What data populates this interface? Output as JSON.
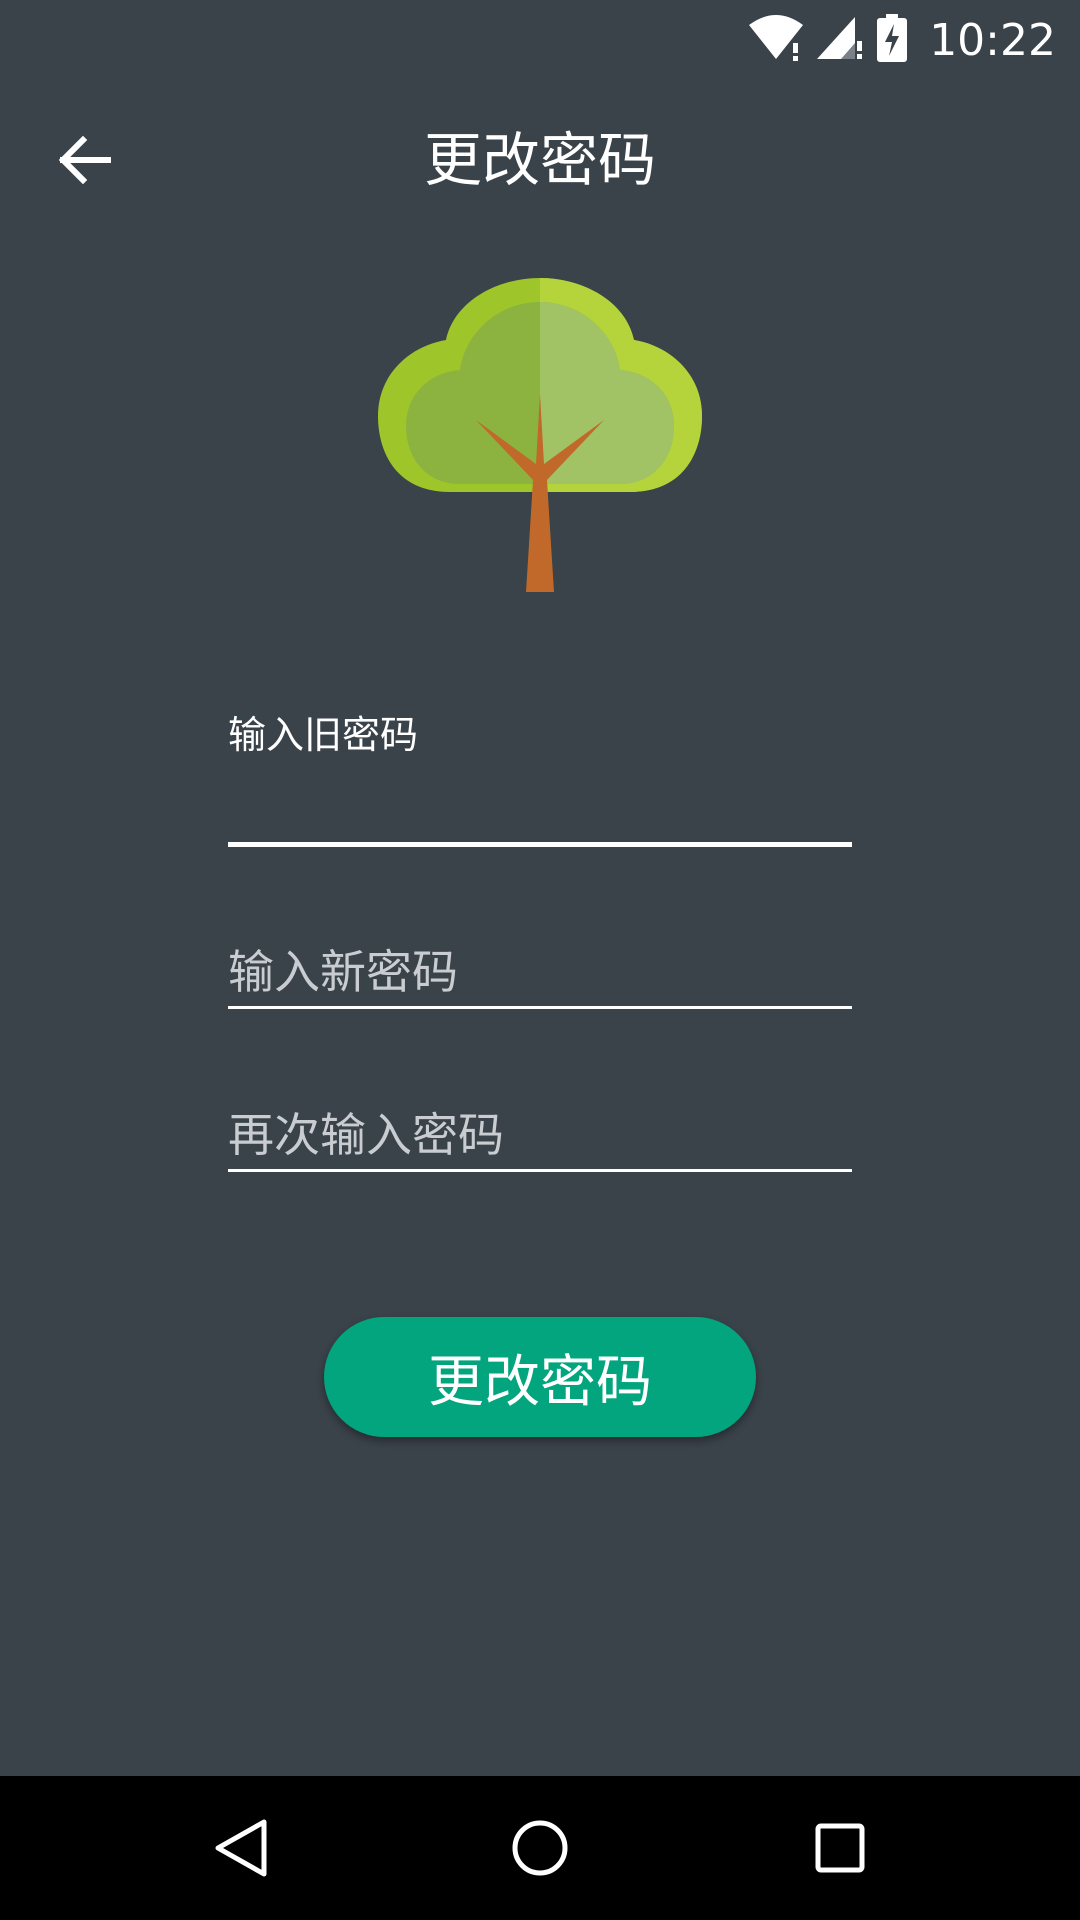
{
  "status_bar": {
    "time": "10:22",
    "icons": [
      "wifi-icon",
      "cell-signal-icon",
      "battery-charging-icon"
    ]
  },
  "app_bar": {
    "title": "更改密码",
    "back_icon": "arrow-back-icon"
  },
  "logo": {
    "icon": "tree-logo"
  },
  "form": {
    "old_password": {
      "label": "输入旧密码",
      "value": ""
    },
    "new_password": {
      "placeholder": "输入新密码",
      "value": ""
    },
    "confirm_password": {
      "placeholder": "再次输入密码",
      "value": ""
    },
    "submit_label": "更改密码"
  },
  "nav_bar": {
    "icons": [
      "nav-back-icon",
      "nav-home-icon",
      "nav-recents-icon"
    ]
  },
  "colors": {
    "background": "#3a424a",
    "accent": "#02a57d",
    "tree_light": "#b5d33a",
    "tree_mid": "#8cb33f",
    "trunk": "#c0692a",
    "nav_bar": "#000000"
  }
}
